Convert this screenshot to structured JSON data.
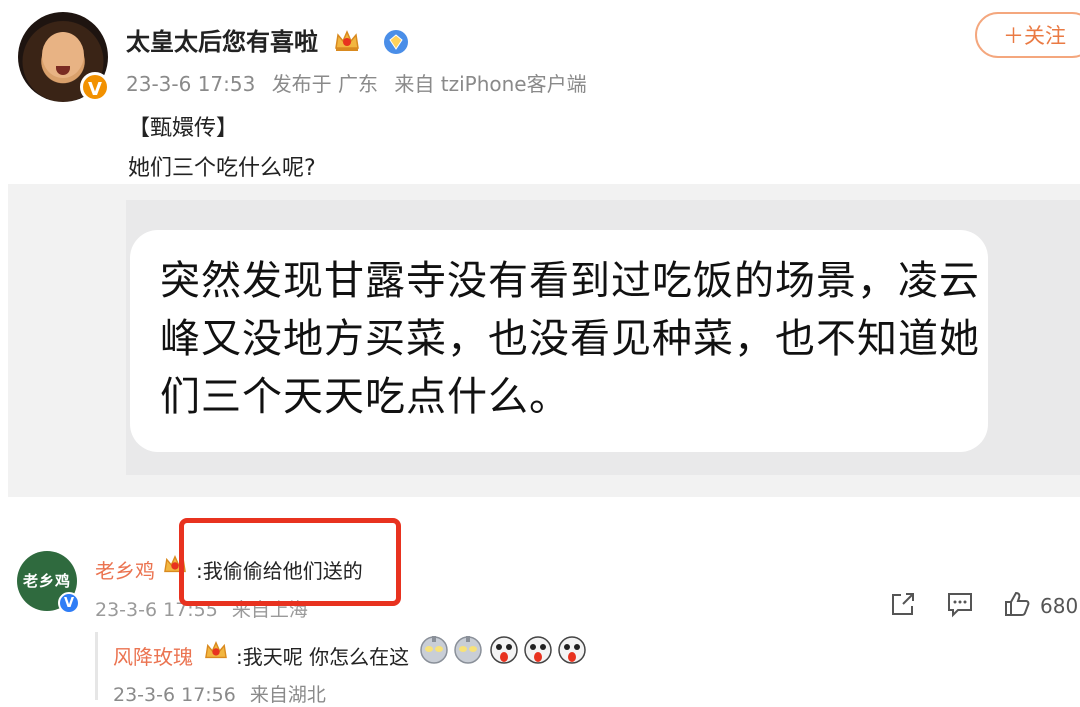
{
  "post": {
    "author": "太皇太后您有喜啦",
    "date": "23-3-6 17:53",
    "location": "发布于 广东",
    "source": "来自 tziPhone客户端",
    "follow_label": "＋关注",
    "line1": "【甄嬛传】",
    "line2": "她们三个吃什么呢?",
    "image_text": "突然发现甘露寺没有看到过吃饭的场景，凌云峰又没地方买菜，也没看见种菜，也不知道她们三个天天吃点什么。"
  },
  "comment": {
    "avatar_text": "老乡鸡",
    "author": "老乡鸡",
    "text": ":我偷偷给他们送的",
    "date": "23-3-6 17:55",
    "source": "来自上海",
    "like_count": "680"
  },
  "reply": {
    "author": "风降玫瑰",
    "text": ":我天呢 你怎么在这",
    "date": "23-3-6 17:56",
    "source": "来自湖北"
  },
  "icons": {
    "verified": "verified-v-icon",
    "crown": "crown-icon",
    "vip": "vip-diamond-icon",
    "share": "share-icon",
    "comment": "comment-icon",
    "like": "thumbs-up-icon",
    "emoji": "emoji-icon"
  },
  "colors": {
    "accent_orange": "#eb7350",
    "highlight_red": "#e8321f",
    "verified_orange": "#f29100",
    "verified_blue": "#2f7df6"
  }
}
